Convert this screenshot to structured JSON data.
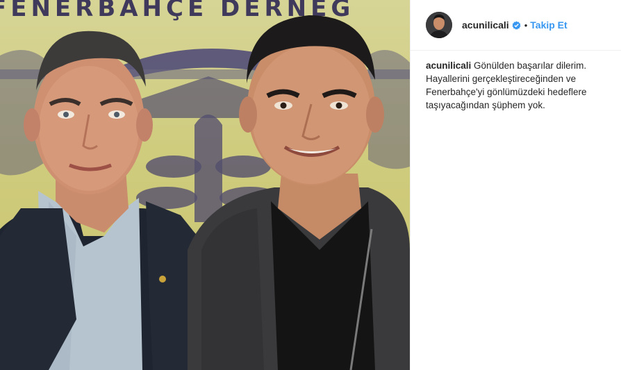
{
  "photo": {
    "banner_text": "FENERBAHÇE DERNEĞ"
  },
  "post": {
    "username": "acunilicali",
    "verified": true,
    "separator": "•",
    "follow_label": "Takip Et",
    "caption_user": "acunilicali",
    "caption_text": "Gönülden başarılar dilerim. Hayallerini gerçekleştireceğinden ve Fenerbahçe'yi gönlümüzdeki hedeflere taşıyacağından şüphem yok."
  },
  "colors": {
    "link": "#3897f0",
    "text": "#262626",
    "banner": "#2f2a55",
    "background_yellow": "#cfcc7e"
  },
  "icons": {
    "verified": "verified-badge-icon"
  }
}
